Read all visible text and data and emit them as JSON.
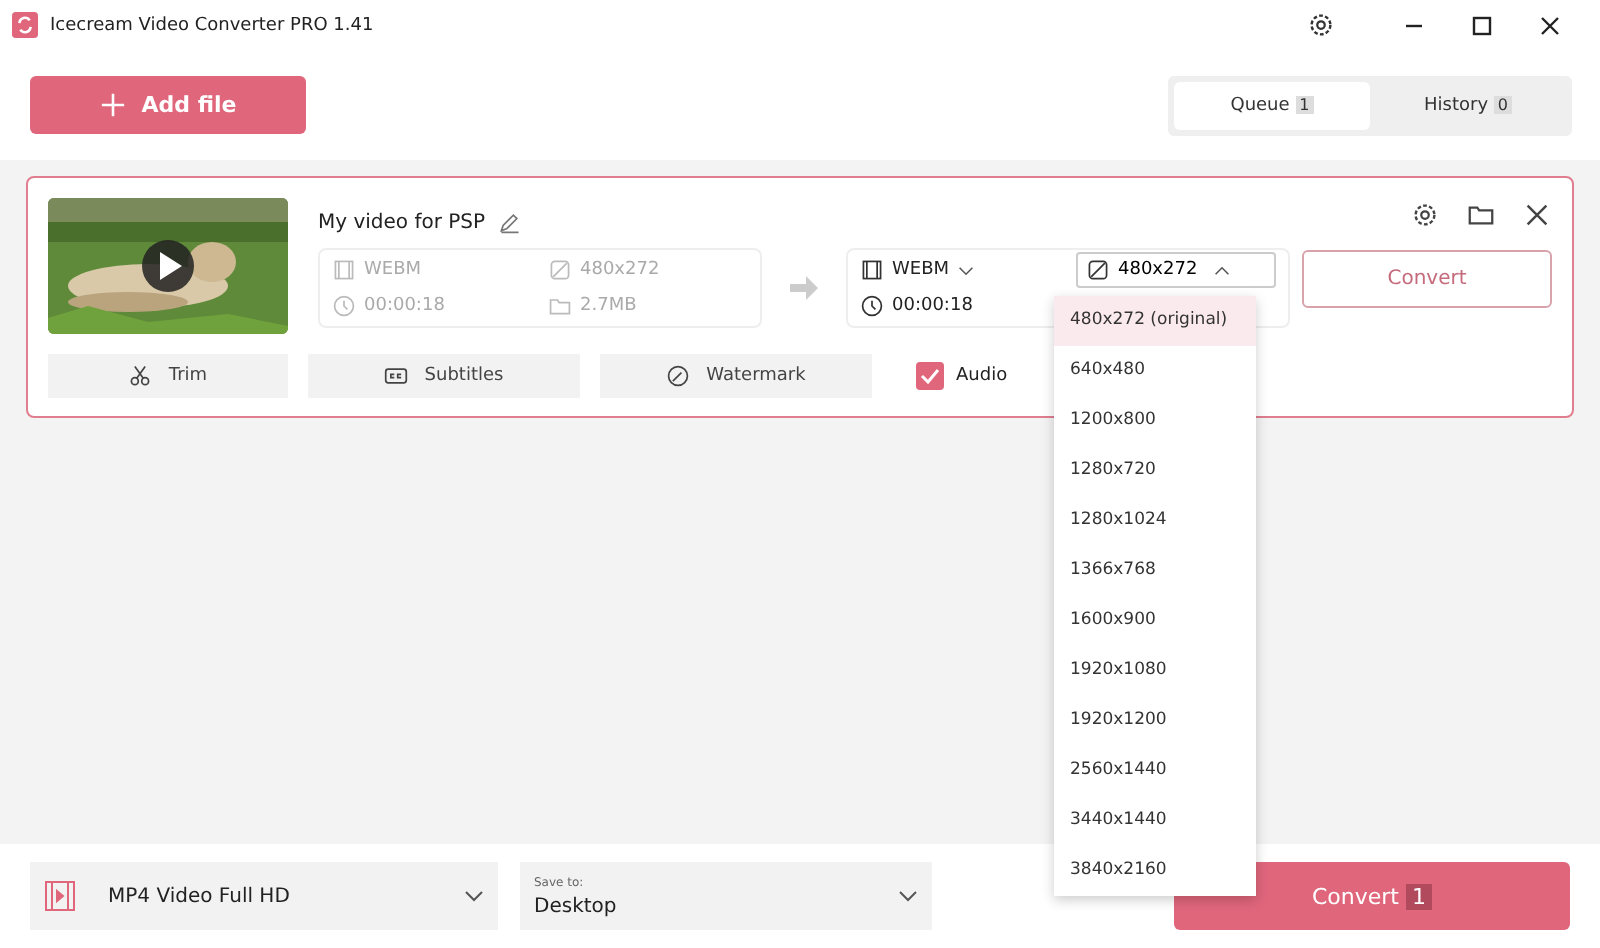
{
  "window": {
    "title": "Icecream Video Converter PRO 1.41"
  },
  "toolbar": {
    "add_button": "Add file",
    "tabs": [
      {
        "label": "Queue",
        "count": "1",
        "selected": true
      },
      {
        "label": "History",
        "count": "0",
        "selected": false
      }
    ]
  },
  "item": {
    "name": "My video for PSP",
    "source": {
      "format": "WEBM",
      "resolution": "480x272",
      "duration": "00:00:18",
      "size": "2.7MB"
    },
    "target": {
      "format": "WEBM",
      "resolution": "480x272",
      "duration": "00:00:18"
    },
    "convert_button": "Convert",
    "actions": [
      "Trim",
      "Subtitles",
      "Watermark"
    ],
    "audio": {
      "label": "Audio",
      "checked": true
    }
  },
  "resolution_menu": [
    {
      "label": "480x272 (original)",
      "selected": true
    },
    {
      "label": "640x480",
      "selected": false
    },
    {
      "label": "1200x800",
      "selected": false
    },
    {
      "label": "1280x720",
      "selected": false
    },
    {
      "label": "1280x1024",
      "selected": false
    },
    {
      "label": "1366x768",
      "selected": false
    },
    {
      "label": "1600x900",
      "selected": false
    },
    {
      "label": "1920x1080",
      "selected": false
    },
    {
      "label": "1920x1200",
      "selected": false
    },
    {
      "label": "2560x1440",
      "selected": false
    },
    {
      "label": "3440x1440",
      "selected": false
    },
    {
      "label": "3840x2160",
      "selected": false
    }
  ],
  "bottom_bar": {
    "preset": "MP4 Video Full HD",
    "save_to_label": "Save to:",
    "save_to": "Desktop",
    "convert_button": "Convert",
    "convert_count": "1"
  }
}
